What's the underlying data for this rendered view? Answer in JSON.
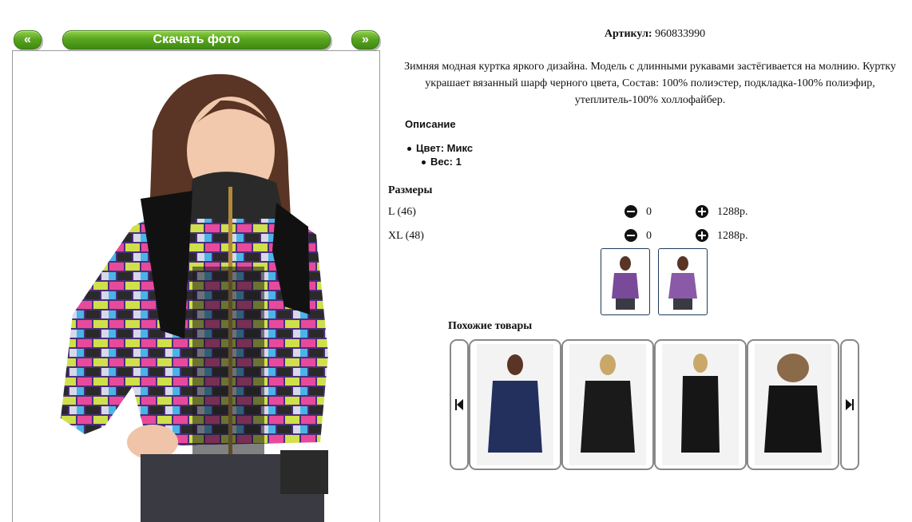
{
  "nav": {
    "prev_label": "«",
    "next_label": "»",
    "download_label": "Скачать фото"
  },
  "product": {
    "article_label": "Артикул:",
    "article_value": "960833990",
    "description": "Зимняя модная куртка яркого дизайна. Модель с длинными рукавами застёгивается на молнию. Куртку украшает вязанный шарф черного цвета, Состав: 100% полиэстер, подкладка-100% полиэфир, утеплитель-100% холлофайбер.",
    "spec_title": "Описание",
    "color_spec": "Цвет: Микс",
    "weight_spec": "Вес: 1"
  },
  "sizes": {
    "title": "Размеры",
    "rows": [
      {
        "label": "L (46)",
        "qty": "0",
        "price": "1288р."
      },
      {
        "label": "XL (48)",
        "qty": "0",
        "price": "1288р."
      }
    ]
  },
  "similar": {
    "title": "Похожие товары"
  },
  "colors": {
    "button_green": "#5aa520",
    "border_dark_blue": "#1d3b5a",
    "frame_gray": "#888888"
  },
  "icons": [
    "minus-circle-icon",
    "plus-circle-icon",
    "skip-back-icon",
    "skip-forward-icon"
  ]
}
